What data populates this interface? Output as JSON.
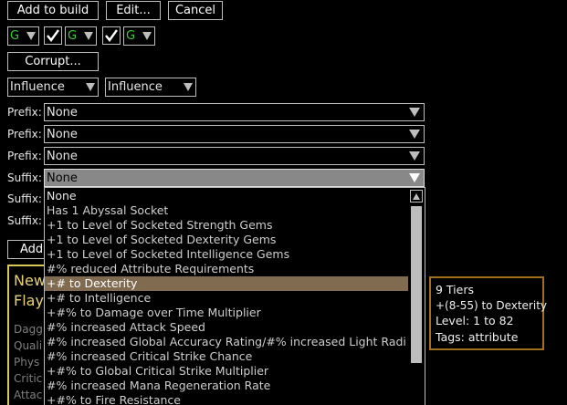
{
  "toolbar": {
    "add_to_build": "Add to build",
    "edit": "Edit...",
    "cancel": "Cancel",
    "corrupt": "Corrupt..."
  },
  "sockets": {
    "color1": "G",
    "color2": "G",
    "color3": "G",
    "link1_checked": true,
    "link2_checked": true,
    "socket_color": "#33cc33"
  },
  "influence": {
    "first": "Influence",
    "second": "Influence"
  },
  "affixes": {
    "prefix_label": "Prefix:",
    "suffix_label": "Suffix:",
    "prefix1": "None",
    "prefix2": "None",
    "prefix3": "None",
    "suffix1": "None",
    "suffix2_label": "Suffix:",
    "suffix3_label": "Suffix:",
    "add_partial": "Add"
  },
  "dropdown_list": {
    "items": [
      "None",
      "Has 1 Abyssal Socket",
      "+1 to Level of Socketed Strength Gems",
      "+1 to Level of Socketed Dexterity Gems",
      "+1 to Level of Socketed Intelligence Gems",
      "#% reduced Attribute Requirements",
      "+# to Dexterity",
      "+# to Intelligence",
      "+#% to Damage over Time Multiplier",
      "#% increased Attack Speed",
      "#% increased Global Accuracy Rating/#% increased Light Radi",
      "#% increased Critical Strike Chance",
      "+#% to Global Critical Strike Multiplier",
      "#% increased Mana Regeneration Rate",
      "+#% to Fire Resistance"
    ],
    "highlighted_index": 6,
    "highlight_color": "#806a50"
  },
  "item_preview": {
    "name_line1": "New",
    "name_line2": "Flay",
    "props": [
      "Dagg",
      "Quali",
      "Phys",
      "Critic",
      "Attac"
    ],
    "border_color": "#d8c85a"
  },
  "tooltip": {
    "tiers": "9 Tiers",
    "range": "+(8-55) to Dexterity",
    "level": "Level: 1 to 82",
    "tags": "Tags: attribute",
    "border_color": "#a0701e"
  }
}
